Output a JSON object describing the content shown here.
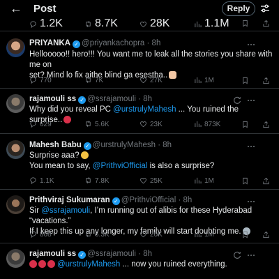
{
  "header": {
    "title": "Post",
    "reply_label": "Reply"
  },
  "top_stats": {
    "replies": "1.2K",
    "reposts": "8.7K",
    "likes": "28K",
    "views": "1.1M"
  },
  "tweets": [
    {
      "name": "PRIYANKA",
      "verified": true,
      "handle": "@priyankachopra",
      "time": "· 8h",
      "text1": "Hellooooo!! hero!!! You want me to leak all the stories you share with me on",
      "text2": "set? Mind lo fix aithe blind ga esestha..",
      "stats": {
        "replies": "770",
        "reposts": "7K",
        "likes": "27K",
        "views": "1M"
      }
    },
    {
      "name": "rajamouli ss",
      "verified": true,
      "handle": "@ssrajamouli",
      "time": "· 8h",
      "text_pre": "Why did you reveal PC ",
      "mention": "@urstrulyMahesh",
      "text_post": " ... You ruined the surprise..",
      "stats": {
        "replies": "629",
        "reposts": "5.6K",
        "likes": "23K",
        "views": "873K"
      }
    },
    {
      "name": "Mahesh Babu",
      "verified": true,
      "handle": "@urstrulyMahesh",
      "time": "· 8h",
      "text1": "Surprise aaa?",
      "text2_pre": "You mean to say, ",
      "mention": "@PrithviOfficial",
      "text2_post": " is also a surprise?",
      "stats": {
        "replies": "1.1K",
        "reposts": "7.8K",
        "likes": "25K",
        "views": "1M"
      }
    },
    {
      "name": "Prithviraj Sukumaran",
      "verified": true,
      "handle": "@PrithviOfficial",
      "time": "· 8h",
      "text1_pre": "Sir ",
      "mention": "@ssrajamouli",
      "text1_post": ", I’m running out of alibis for these Hyderabad “vacations.”",
      "text2": "If I keep this up any longer, my family will start doubting me.",
      "stats": {
        "replies": "808",
        "reposts": "6.3K",
        "likes": "20K",
        "views": "1M"
      }
    },
    {
      "name": "rajamouli ss",
      "verified": true,
      "handle": "@ssrajamouli",
      "time": "· 8h",
      "mention": "@urstrulyMahesh",
      "text_post": " ... now you ruined everything."
    }
  ],
  "colors": {
    "accent": "#1d9bf0",
    "muted": "#71767b",
    "text": "#e7e9ea",
    "divider": "#2f3336"
  },
  "icons": [
    "back-arrow-icon",
    "sliders-icon",
    "reply-icon",
    "repost-icon",
    "like-icon",
    "views-icon",
    "bookmark-icon",
    "share-icon",
    "more-icon",
    "grok-icon",
    "verified-icon"
  ]
}
